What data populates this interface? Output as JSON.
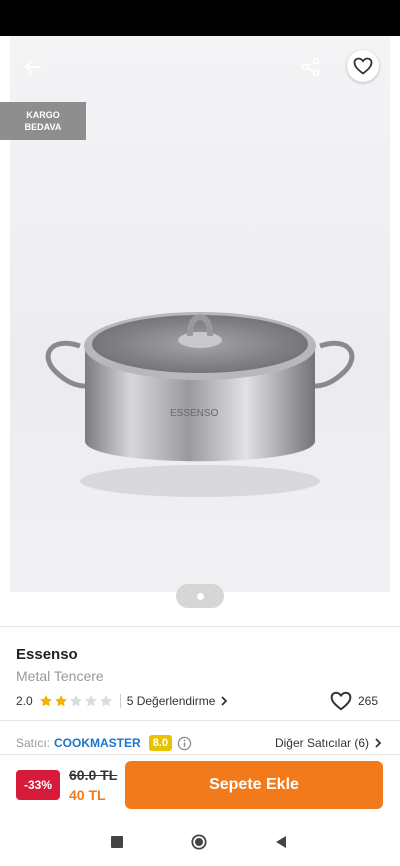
{
  "icons": {
    "back": "arrow-left-icon",
    "share": "share-icon",
    "favorite": "heart-outline-icon",
    "info": "info-circle-icon",
    "chevron": "chevron-right-icon",
    "nav_recent": "square-icon",
    "nav_home": "circle-icon",
    "nav_back": "triangle-back-icon"
  },
  "colors": {
    "accent": "#f27a1a",
    "discount": "#d61b3a",
    "seller_link": "#1d74c9",
    "score_badge": "#e6c200",
    "star_filled": "#f5b301",
    "star_empty": "#dcdcdc"
  },
  "gallery": {
    "badge_line1": "KARGO",
    "badge_line2": "BEDAVA",
    "product_logo": "ESSENSO",
    "current_page": 1,
    "page_count": 1
  },
  "product": {
    "brand": "Essenso",
    "name": "Metal Tencere",
    "rating": "2.0",
    "rating_value": 2,
    "rating_max": 5,
    "reviews_label": "5 Değerlendirme",
    "likes": "265"
  },
  "seller": {
    "label": "Satıcı:",
    "name": "COOKMASTER",
    "score": "8.0",
    "other_sellers": "Diğer Satıcılar (6)"
  },
  "buy": {
    "discount": "-33%",
    "old_price": "60.0 TL",
    "new_price": "40 TL",
    "add_to_cart": "Sepete Ekle"
  }
}
